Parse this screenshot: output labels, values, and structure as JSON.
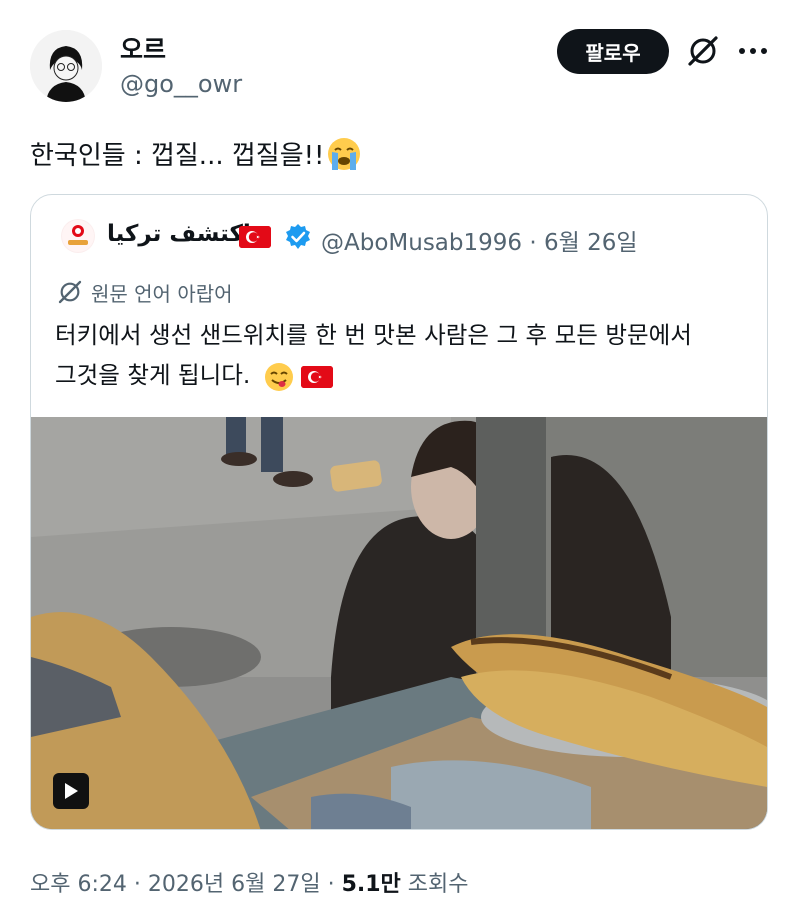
{
  "author": {
    "display_name": "오르",
    "handle": "@go__owr"
  },
  "actions": {
    "follow_label": "팔로우",
    "grok_icon": "grok-slash-icon",
    "more_icon": "more-dots-icon"
  },
  "tweet": {
    "text": "한국인들 : 껍질... 껍질을!!",
    "emoji": "loudly-crying-face"
  },
  "quote": {
    "name": "اكتشف تركيا",
    "handle": "@AboMusab1996",
    "date": "6월 26일",
    "handle_date": "@AboMusab1996 · 6월 26일",
    "translate_label": "원문 언어 아랍어",
    "body_line1": "터키에서 생선 샌드위치를 한 번 맛본 사람은 그 후 모든 방문에서",
    "body_line2": "그것을 찾게 됩니다.",
    "media_type": "video",
    "flag_color": "#e30a17",
    "verified_color": "#1d9bf0"
  },
  "footer": {
    "time": "오후 6:24",
    "date": "2026년 6월 27일",
    "views": "5.1만",
    "views_label": "조회수"
  }
}
